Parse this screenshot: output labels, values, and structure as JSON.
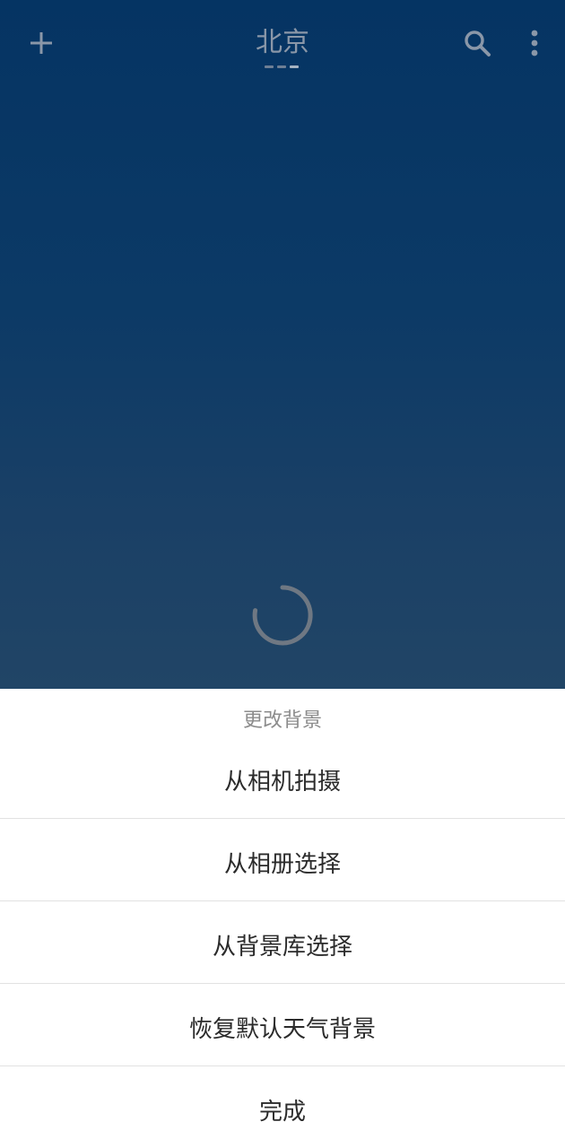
{
  "header": {
    "city": "北京",
    "add_icon": "plus-icon",
    "search_icon": "search-icon",
    "more_icon": "more-vertical-icon",
    "page_count": 3,
    "active_page": 3
  },
  "content": {
    "loading": true
  },
  "sheet": {
    "title": "更改背景",
    "items": [
      {
        "label": "从相机拍摄"
      },
      {
        "label": "从相册选择"
      },
      {
        "label": "从背景库选择"
      },
      {
        "label": "恢复默认天气背景"
      },
      {
        "label": "完成"
      }
    ]
  },
  "colors": {
    "background_top": "#053463",
    "background_bottom": "#214566",
    "header_icon": "#8a97a8",
    "sheet_bg": "#ffffff",
    "sheet_title": "#8c8c8c",
    "sheet_item_text": "#2b2b2b",
    "divider": "#e2e2e2"
  }
}
